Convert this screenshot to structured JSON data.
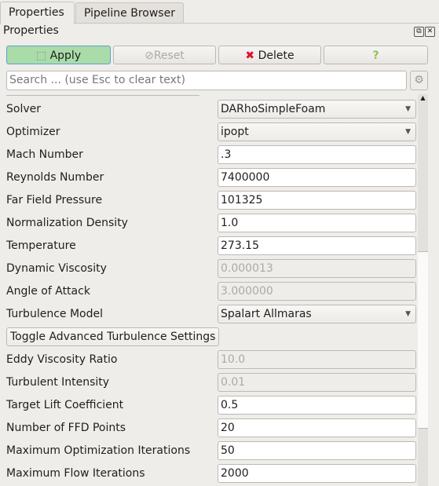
{
  "tabs": [
    {
      "label": "Properties",
      "active": true
    },
    {
      "label": "Pipeline Browser",
      "active": false
    }
  ],
  "panel_title": "Properties",
  "buttons": {
    "apply": "Apply",
    "reset": "Reset",
    "delete": "Delete",
    "help": "?"
  },
  "colors": {
    "apply_bg": "#a9dca8",
    "delete_icon": "#e0102a",
    "help_icon": "#8fc24a"
  },
  "search": {
    "placeholder": "Search ... (use Esc to clear text)",
    "value": ""
  },
  "properties": [
    {
      "label": "Solver",
      "value": "DARhoSimpleFoam",
      "type": "combo"
    },
    {
      "label": "Optimizer",
      "value": "ipopt",
      "type": "combo"
    },
    {
      "label": "Mach Number",
      "value": ".3",
      "type": "text"
    },
    {
      "label": "Reynolds Number",
      "value": "7400000",
      "type": "text"
    },
    {
      "label": "Far Field Pressure",
      "value": "101325",
      "type": "text"
    },
    {
      "label": "Normalization Density",
      "value": "1.0",
      "type": "text"
    },
    {
      "label": "Temperature",
      "value": "273.15",
      "type": "text"
    },
    {
      "label": "Dynamic Viscosity",
      "value": "0.000013",
      "type": "disabled"
    },
    {
      "label": "Angle of Attack",
      "value": "3.000000",
      "type": "disabled"
    },
    {
      "label": "Turbulence Model",
      "value": "Spalart Allmaras",
      "type": "combo"
    },
    {
      "label": "",
      "value": "Toggle Advanced Turbulence Settings",
      "type": "button"
    },
    {
      "label": "Eddy Viscosity Ratio",
      "value": "10.0",
      "type": "disabled"
    },
    {
      "label": "Turbulent Intensity",
      "value": "0.01",
      "type": "disabled"
    },
    {
      "label": "Target Lift Coefficient",
      "value": "0.5",
      "type": "text"
    },
    {
      "label": "Number of FFD Points",
      "value": "20",
      "type": "text"
    },
    {
      "label": "Maximum Optimization Iterations",
      "value": "50",
      "type": "text"
    },
    {
      "label": "Maximum Flow Iterations",
      "value": "2000",
      "type": "text"
    }
  ]
}
